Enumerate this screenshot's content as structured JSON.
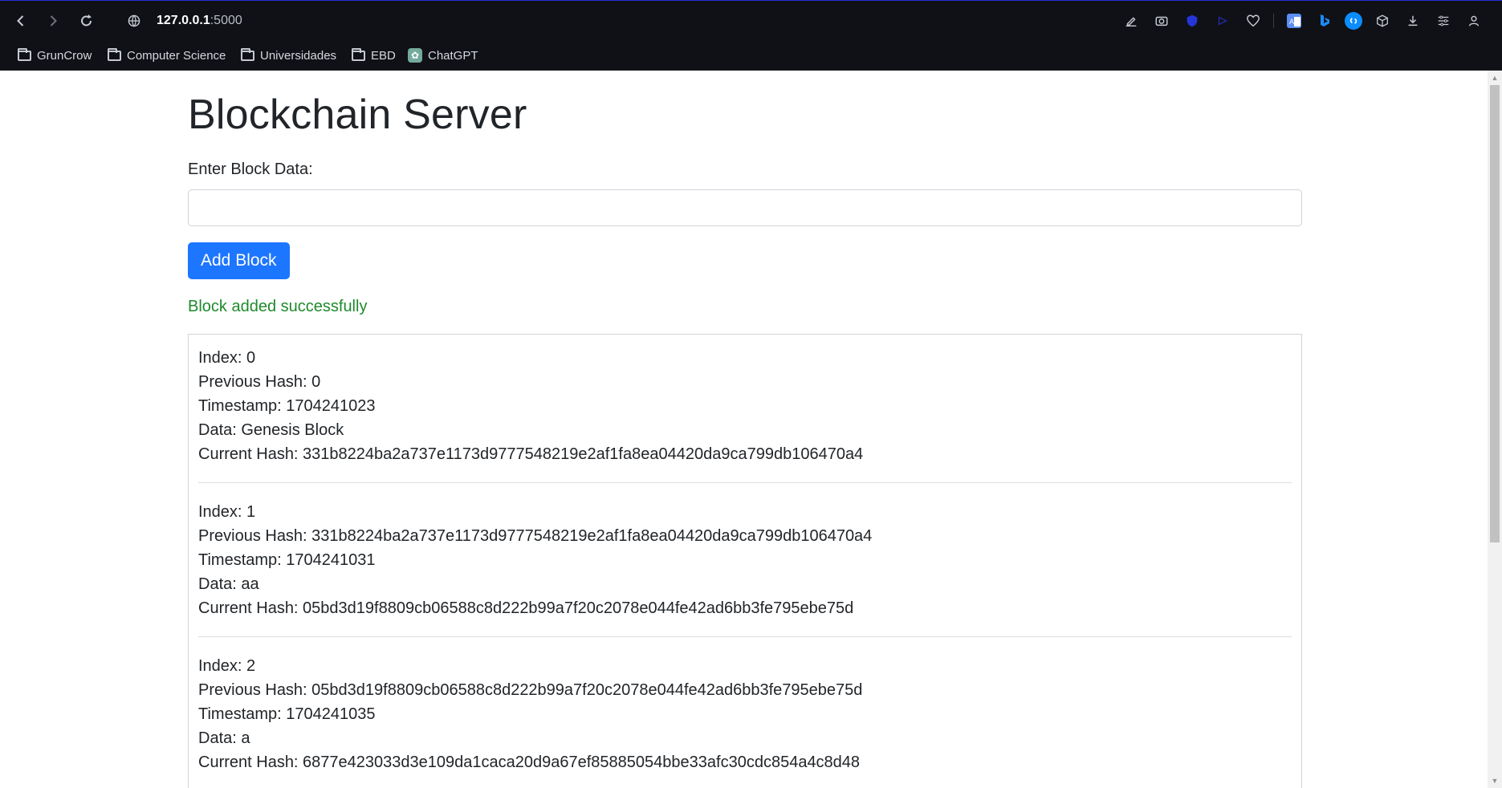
{
  "browser": {
    "url_host": "127.0.0.1",
    "url_rest": ":5000",
    "bookmarks": [
      {
        "label": "GrunCrow",
        "icon": "folder-icon"
      },
      {
        "label": "Computer Science",
        "icon": "folder-icon"
      },
      {
        "label": "Universidades",
        "icon": "folder-icon"
      },
      {
        "label": "EBD",
        "icon": "folder-icon"
      },
      {
        "label": "ChatGPT",
        "icon": "chatgpt-icon"
      }
    ]
  },
  "page": {
    "title": "Blockchain Server",
    "input_label": "Enter Block Data:",
    "input_value": "",
    "add_button": "Add Block",
    "status_message": "Block added successfully",
    "colors": {
      "button": "#1d76ff",
      "success": "#1e8a2b"
    }
  },
  "blocks": [
    {
      "index": "Index: 0",
      "previous_hash": "Previous Hash: 0",
      "timestamp": "Timestamp: 1704241023",
      "data": "Data: Genesis Block",
      "current_hash": "Current Hash: 331b8224ba2a737e1173d9777548219e2af1fa8ea04420da9ca799db106470a4"
    },
    {
      "index": "Index: 1",
      "previous_hash": "Previous Hash: 331b8224ba2a737e1173d9777548219e2af1fa8ea04420da9ca799db106470a4",
      "timestamp": "Timestamp: 1704241031",
      "data": "Data: aa",
      "current_hash": "Current Hash: 05bd3d19f8809cb06588c8d222b99a7f20c2078e044fe42ad6bb3fe795ebe75d"
    },
    {
      "index": "Index: 2",
      "previous_hash": "Previous Hash: 05bd3d19f8809cb06588c8d222b99a7f20c2078e044fe42ad6bb3fe795ebe75d",
      "timestamp": "Timestamp: 1704241035",
      "data": "Data: a",
      "current_hash": "Current Hash: 6877e423033d3e109da1caca20d9a67ef85885054bbe33afc30cdc854a4c8d48"
    }
  ]
}
